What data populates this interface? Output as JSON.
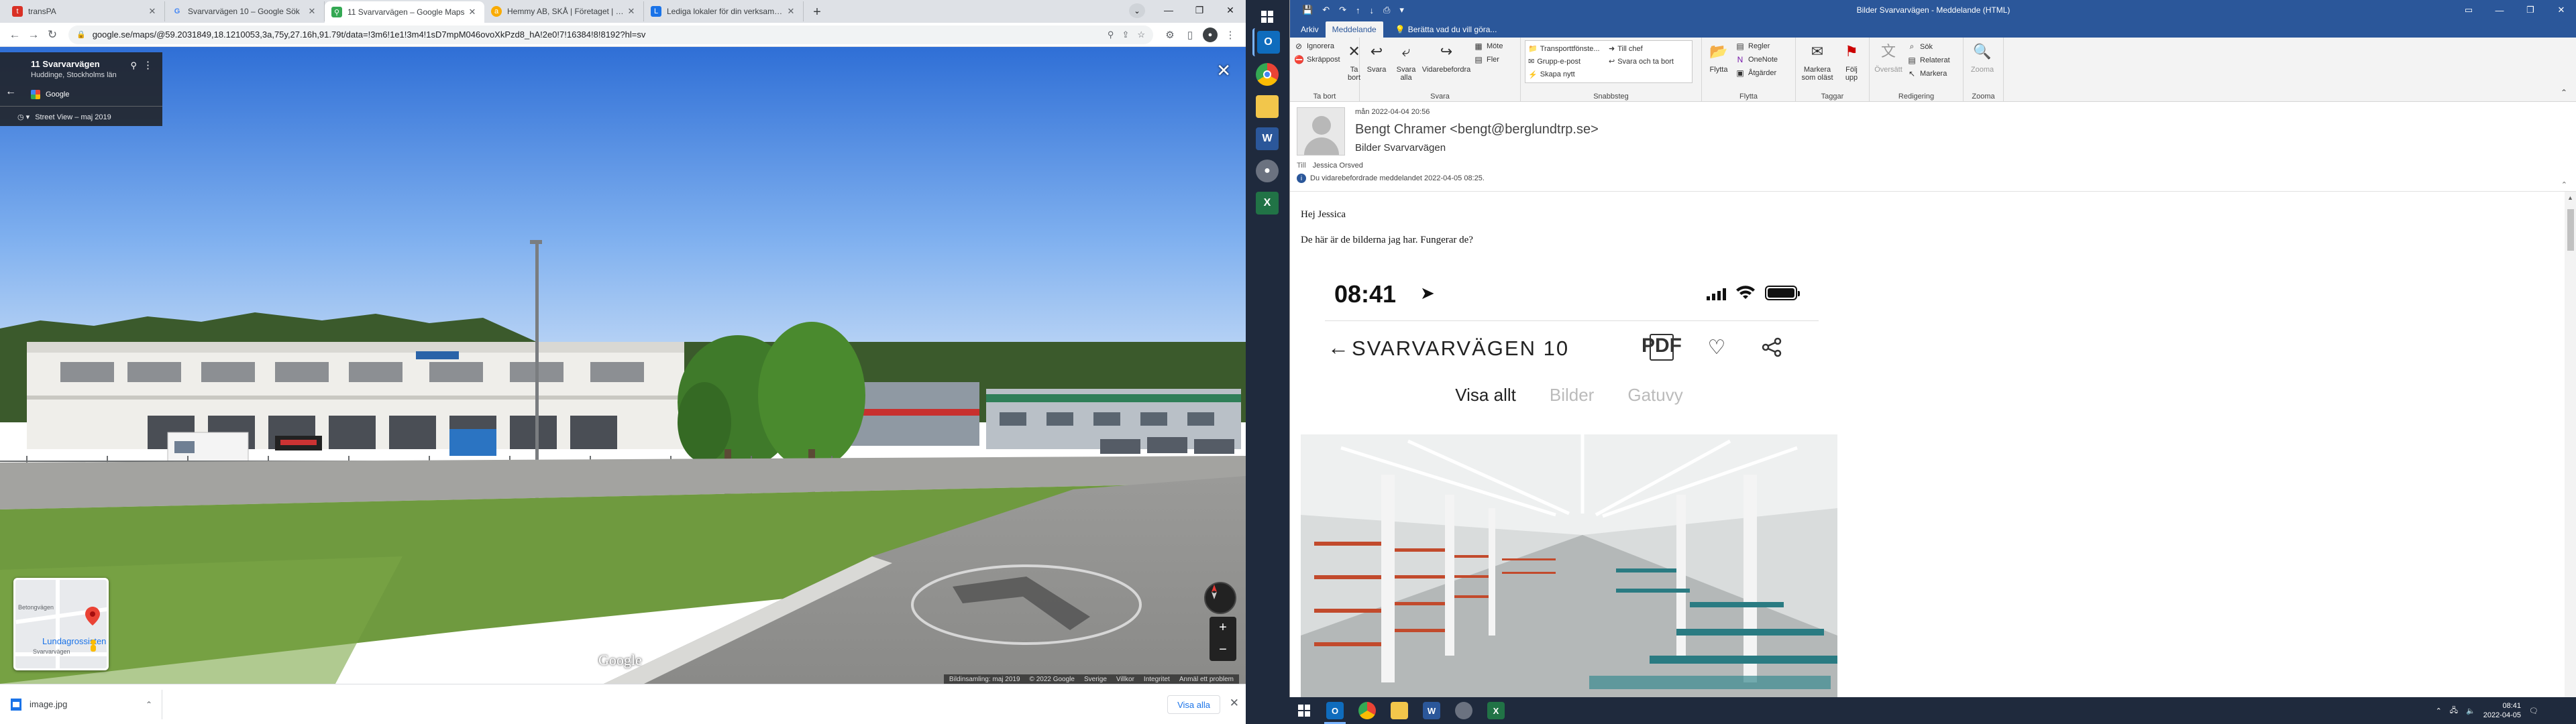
{
  "browser": {
    "tabs": [
      {
        "title": "transPA",
        "favicon": "page-icon",
        "color": "#d93025"
      },
      {
        "title": "Svarvarvägen 10 – Google Sök",
        "favicon": "google-icon",
        "color": "#4285f4"
      },
      {
        "title": "11 Svarvarvägen – Google Maps",
        "favicon": "maps-icon",
        "color": "#34a853"
      },
      {
        "title": "Hemmy AB, SKÅ | Företaget | en...",
        "favicon": "allabolag-icon",
        "color": "#f9ab00"
      },
      {
        "title": "Lediga lokaler för din verksamhet...",
        "favicon": "lokal-icon",
        "color": "#1a73e8"
      }
    ],
    "url": "google.se/maps/@59.2031849,18.1210053,3a,75y,27.16h,91.79t/data=!3m6!1e1!3m4!1sD7mpM046ovoXkPzd8_hA!2e0!7!16384!8!8192?hl=sv",
    "streetview": {
      "place_title": "11 Svarvarvägen",
      "place_sub": "Huddinge, Stockholms län",
      "provider": "Google",
      "date_label": "Street View – maj 2019",
      "watermark": "Google",
      "footer": [
        "Bildinsamling: maj 2019",
        "© 2022 Google",
        "Sverige",
        "Villkor",
        "Integritet",
        "Anmäl ett problem"
      ],
      "minimap": {
        "label_road1": "Betongvägen",
        "label_road2": "Svarvarvägen",
        "label_place": "Lundagrossisten"
      }
    },
    "downloads": {
      "file": "image.jpg",
      "show_all": "Visa alla"
    }
  },
  "outlook": {
    "window_title": "Bilder Svarvarvägen - Meddelande (HTML)",
    "ribbon_tabs": [
      "Arkiv",
      "Meddelande"
    ],
    "tell_me": "Berätta vad du vill göra...",
    "groups": {
      "delete": {
        "label": "Ta bort",
        "ignore": "Ignorera",
        "junk": "Skräppost",
        "delete_btn": "Ta bort"
      },
      "respond": {
        "label": "Svara",
        "reply": "Svara",
        "reply_all": "Svara alla",
        "forward": "Vidarebefordra",
        "meeting": "Möte",
        "more": "Fler"
      },
      "quick": {
        "label": "Snabbsteg",
        "items": [
          "Transporttfönste...",
          "Till chef",
          "Grupp-e-post",
          "Svara och ta bort",
          "Skapa nytt",
          ""
        ]
      },
      "move": {
        "label": "Flytta",
        "move_btn": "Flytta",
        "rules": "Regler",
        "onenote": "OneNote",
        "actions": "Åtgärder"
      },
      "tags": {
        "label": "Taggar",
        "unread": "Markera som oläst",
        "follow": "Följ upp"
      },
      "edit": {
        "label": "Redigering",
        "translate": "Översätt",
        "search": "Sök",
        "related": "Relaterat",
        "select": "Markera"
      },
      "zoom": {
        "label": "Zooma",
        "zoom_btn": "Zooma"
      }
    },
    "message": {
      "date": "mån 2022-04-04 20:56",
      "from": "Bengt Chramer <bengt@berglundtrp.se>",
      "subject": "Bilder Svarvarvägen",
      "to_label": "Till",
      "to": "Jessica Orsved",
      "info": "Du vidarebefordrade meddelandet 2022-04-05 08:25.",
      "greeting": "Hej Jessica",
      "body": "De här är de bilderna jag har. Fungerar de?"
    },
    "phone_screenshot": {
      "time": "08:41",
      "title": "SVARVARVÄGEN 10",
      "tabs": [
        "Visa allt",
        "Bilder",
        "Gatuvy"
      ]
    }
  },
  "taskbar": {
    "time": "08:41",
    "date": "2022-04-05"
  }
}
